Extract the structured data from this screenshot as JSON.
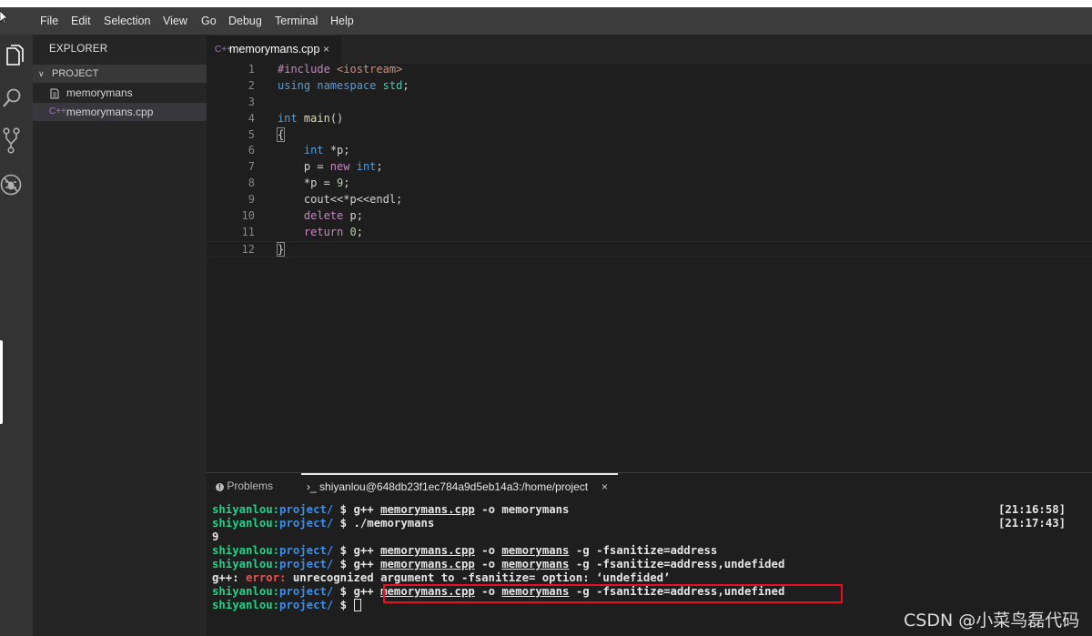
{
  "menu": [
    "File",
    "Edit",
    "Selection",
    "View",
    "Go",
    "Debug",
    "Terminal",
    "Help"
  ],
  "activity": [
    "files-icon",
    "search-icon",
    "source-control-icon",
    "extensions-icon"
  ],
  "explorer": {
    "title": "EXPLORER",
    "section": "PROJECT",
    "files": [
      {
        "name": "memorymans",
        "icon": "file-icon",
        "selected": false
      },
      {
        "name": "memorymans.cpp",
        "icon": "cpp-file-icon",
        "selected": true
      }
    ]
  },
  "editor": {
    "tab": "memorymans.cpp",
    "tab_icon": "C++",
    "line_numbers": [
      "1",
      "2",
      "3",
      "4",
      "5",
      "6",
      "7",
      "8",
      "9",
      "10",
      "11",
      "12"
    ],
    "code": [
      "#include <iostream>",
      "using namespace std;",
      "",
      "int main()",
      "{",
      "    int *p;",
      "    p = new int;",
      "    *p = 9;",
      "    cout<<*p<<endl;",
      "    delete p;",
      "    return 0;",
      "}"
    ]
  },
  "panel": {
    "problems_tab": "Problems",
    "terminal_tab": "shiyanlou@648db23f1ec784a9d5eb14a3:/home/project",
    "terminal_prefix": "›_"
  },
  "terminal": {
    "user": "shiyanlou:",
    "path": "project/",
    "prompt": " $ ",
    "lines": [
      {
        "type": "cmd",
        "parts": [
          "g++ ",
          "memorymans.cpp",
          " -o memorymans"
        ],
        "ul": [
          1
        ],
        "time": "[21:16:58]"
      },
      {
        "type": "cmd",
        "parts": [
          "./memorymans"
        ],
        "ul": [],
        "time": "[21:17:43]",
        "dim": true
      },
      {
        "type": "out",
        "text": "9"
      },
      {
        "type": "cmd",
        "parts": [
          "g++ ",
          "memorymans.cpp",
          " -o ",
          "memorymans",
          " -g -fsanitize=address"
        ],
        "ul": [
          1,
          3
        ]
      },
      {
        "type": "cmd",
        "parts": [
          "g++ ",
          "memorymans.cpp",
          " -o ",
          "memorymans",
          " -g -fsanitize=address,undefided"
        ],
        "ul": [
          1,
          3
        ]
      },
      {
        "type": "err",
        "prefix": "g++: ",
        "error": "error:",
        "text": " unrecognized argument to -fsanitize= option: ‘undefided’"
      },
      {
        "type": "cmd",
        "parts": [
          "g++ ",
          "memorymans.cpp",
          " -o ",
          "memorymans",
          " -g -fsanitize=address,undefined"
        ],
        "ul": [
          1,
          3
        ]
      },
      {
        "type": "prompt"
      }
    ]
  },
  "watermark": "CSDN @小菜鸟磊代码"
}
